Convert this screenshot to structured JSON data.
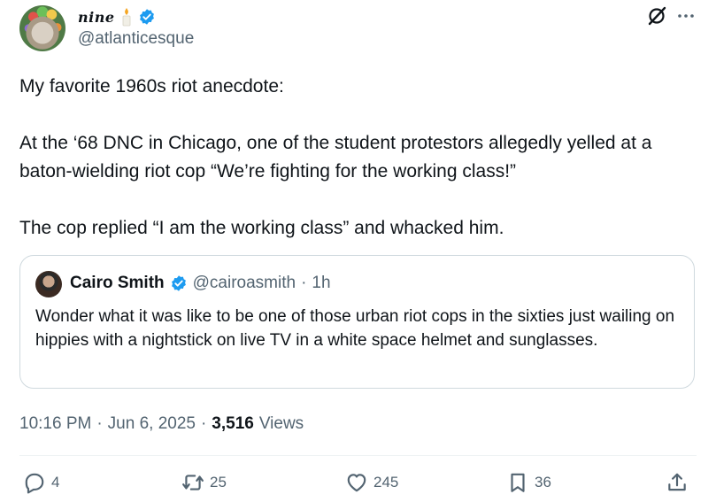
{
  "author": {
    "display_name": "nine",
    "handle": "@atlanticesque"
  },
  "tweet": {
    "paragraphs": [
      "My favorite 1960s riot anecdote:",
      "At the ‘68 DNC in Chicago, one of the student protestors allegedly yelled at a baton-wielding riot cop “We’re fighting for the working class!”",
      "The cop replied “I am the working class” and whacked him."
    ]
  },
  "quote": {
    "name": "Cairo Smith",
    "handle": "@cairoasmith",
    "separator": "·",
    "time": "1h",
    "text": "Wonder what it was like to be one of those urban riot cops in the sixties just wailing on hippies with a nightstick on live TV in a white space helmet and sunglasses."
  },
  "meta": {
    "time": "10:16 PM",
    "sep1": "·",
    "date": "Jun 6, 2025",
    "sep2": "·",
    "views_count": "3,516",
    "views_label": "Views"
  },
  "actions": {
    "replies": "4",
    "reposts": "25",
    "likes": "245",
    "bookmarks": "36"
  },
  "icons": [
    "candle-icon",
    "verified-icon",
    "grok-icon",
    "more-icon",
    "reply-icon",
    "repost-icon",
    "like-icon",
    "bookmark-icon",
    "share-icon"
  ],
  "colors": {
    "verified": "#1d9bf0",
    "secondary_text": "#536471",
    "border": "#cfd9de"
  }
}
